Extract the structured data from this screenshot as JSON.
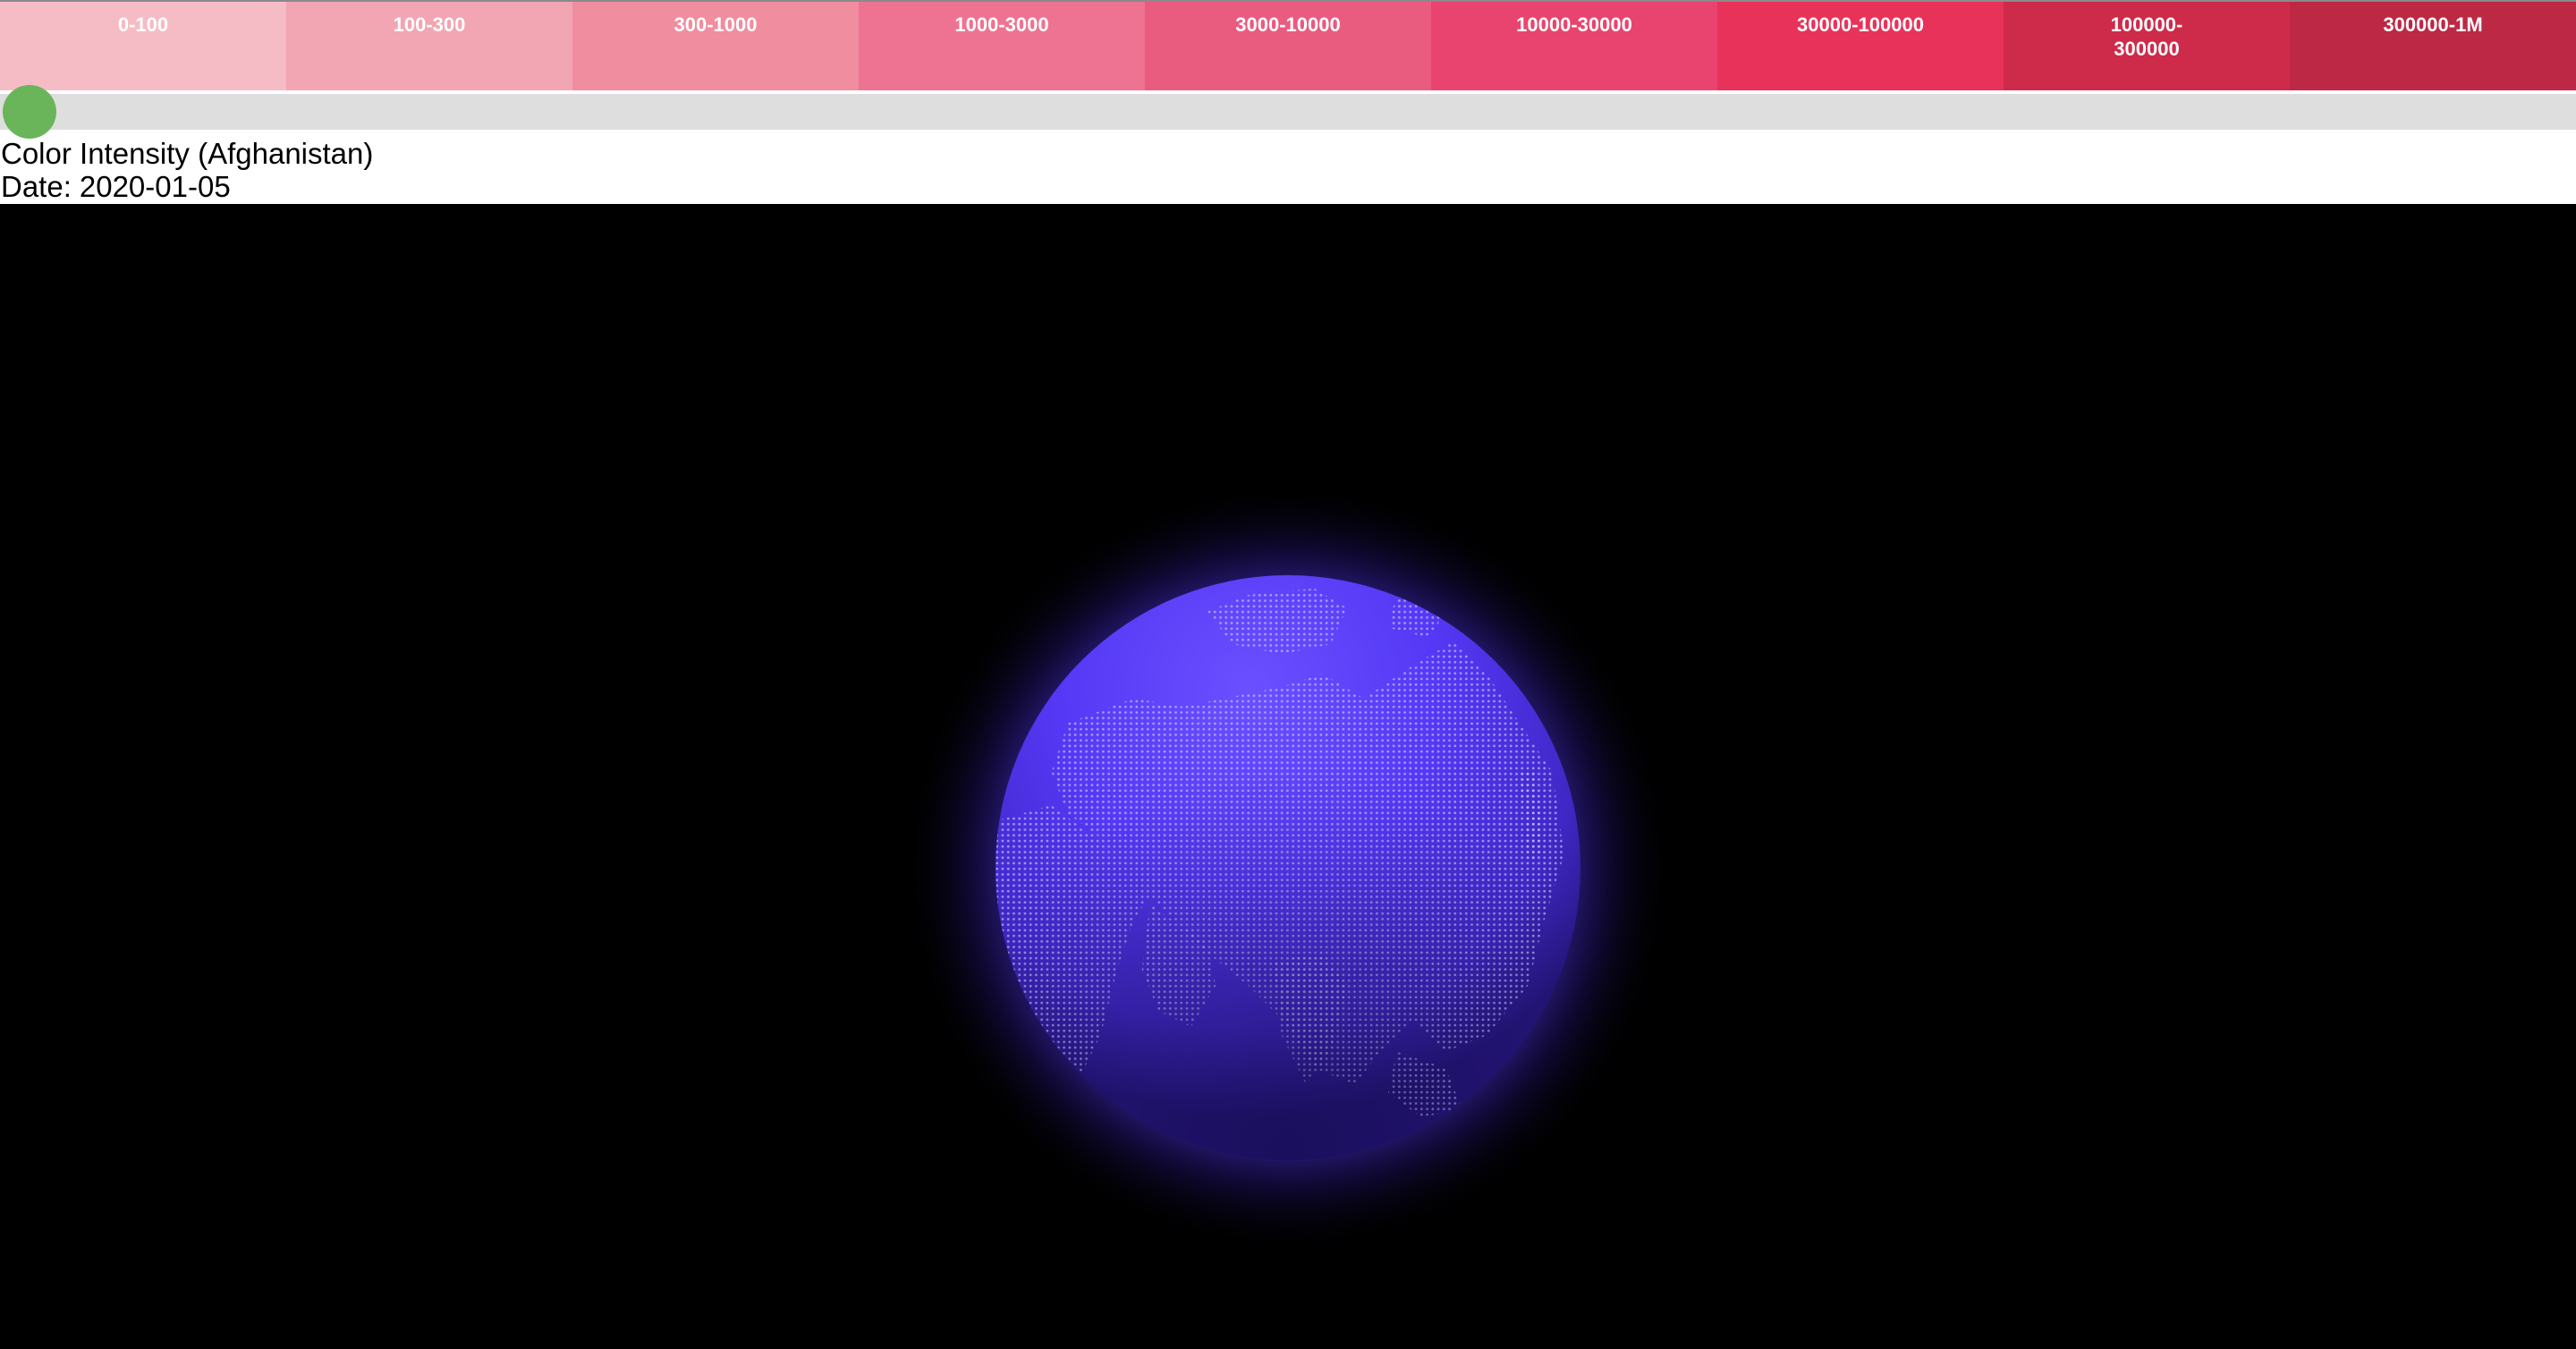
{
  "legend": {
    "bins": [
      {
        "label": "0-100",
        "color": "#f5bcc6"
      },
      {
        "label": "100-300",
        "color": "#f2a5b2"
      },
      {
        "label": "300-1000",
        "color": "#f08d9e"
      },
      {
        "label": "1000-3000",
        "color": "#ee7392"
      },
      {
        "label": "3000-10000",
        "color": "#ea5b80"
      },
      {
        "label": "10000-30000",
        "color": "#e9446f"
      },
      {
        "label": "30000-100000",
        "color": "#e8325a"
      },
      {
        "label": "100000-300000",
        "color": "#ce2a4a"
      },
      {
        "label": "300000-1M",
        "color": "#bd2845"
      }
    ]
  },
  "slider": {
    "value_fraction": 0,
    "track_color": "#dedede",
    "thumb_color": "#6ab55a"
  },
  "info": {
    "title": "Color Intensity (Afghanistan)",
    "date_label": "Date:",
    "date_value": "2020-01-05"
  },
  "globe": {
    "ocean_color": "#5438f5",
    "land_dot_color": "#c9c0ff",
    "glow_color": "#5a3cff",
    "background_color": "#000000"
  }
}
